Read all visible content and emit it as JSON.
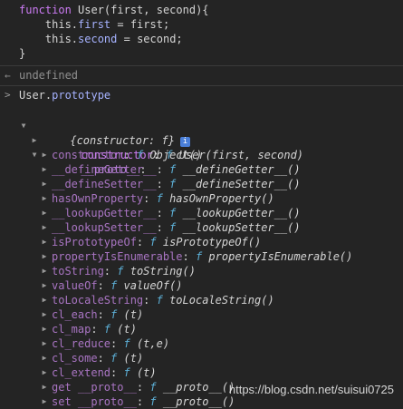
{
  "code": {
    "line1": {
      "kw": "function",
      "name": " User(first, second){"
    },
    "line2": {
      "pre": "    this.",
      "prop": "first",
      "post": " = first;"
    },
    "line3": {
      "pre": "    this.",
      "prop": "second",
      "post": " = second;"
    },
    "line4": "}"
  },
  "result": {
    "glyph": "←",
    "text": "undefined"
  },
  "input": {
    "glyph": ">",
    "obj": "User.",
    "prop": "prototype"
  },
  "tree": {
    "root_label": "{constructor: f}",
    "info_icon": "i",
    "constructor_key": "constructor",
    "constructor_f": "f",
    "constructor_sig": "User(first, second)",
    "proto_key": "__proto__",
    "proto_items": [
      {
        "key": "constructor",
        "f": "f",
        "sig": "Object()"
      },
      {
        "key": "__defineGetter__",
        "f": "f",
        "sig": "__defineGetter__()"
      },
      {
        "key": "__defineSetter__",
        "f": "f",
        "sig": "__defineSetter__()"
      },
      {
        "key": "hasOwnProperty",
        "f": "f",
        "sig": "hasOwnProperty()"
      },
      {
        "key": "__lookupGetter__",
        "f": "f",
        "sig": "__lookupGetter__()"
      },
      {
        "key": "__lookupSetter__",
        "f": "f",
        "sig": "__lookupSetter__()"
      },
      {
        "key": "isPrototypeOf",
        "f": "f",
        "sig": "isPrototypeOf()"
      },
      {
        "key": "propertyIsEnumerable",
        "f": "f",
        "sig": "propertyIsEnumerable()"
      },
      {
        "key": "toString",
        "f": "f",
        "sig": "toString()"
      },
      {
        "key": "valueOf",
        "f": "f",
        "sig": "valueOf()"
      },
      {
        "key": "toLocaleString",
        "f": "f",
        "sig": "toLocaleString()"
      },
      {
        "key": "cl_each",
        "f": "f",
        "sig": "(t)"
      },
      {
        "key": "cl_map",
        "f": "f",
        "sig": "(t)"
      },
      {
        "key": "cl_reduce",
        "f": "f",
        "sig": "(t,e)"
      },
      {
        "key": "cl_some",
        "f": "f",
        "sig": "(t)"
      },
      {
        "key": "cl_extend",
        "f": "f",
        "sig": "(t)"
      },
      {
        "key": "get __proto__",
        "f": "f",
        "sig": "__proto__()"
      },
      {
        "key": "set __proto__",
        "f": "f",
        "sig": "__proto__()"
      }
    ]
  },
  "watermark": "https://blog.csdn.net/suisui0725",
  "colors": {
    "background": "#242424",
    "keyword": "#cc7bf4",
    "property": "#a6b2ff",
    "function_f": "#5db0d7",
    "info_badge": "#4a7fd9"
  }
}
